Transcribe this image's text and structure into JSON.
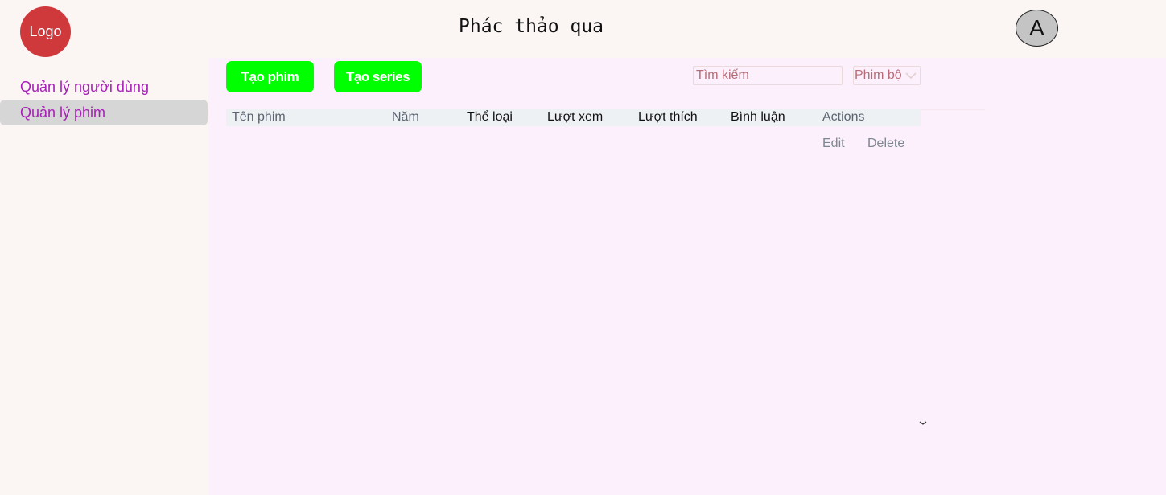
{
  "header": {
    "logo_text": "Logo",
    "title": "Phác thảo qua",
    "avatar_letter": "A"
  },
  "sidebar": {
    "items": [
      {
        "label": "Quản lý người dùng",
        "active": false
      },
      {
        "label": "Quản lý phim",
        "active": true
      }
    ]
  },
  "toolbar": {
    "create_movie_label": "Tạo phim",
    "create_series_label": "Tạo series",
    "button_color": "#00ff00",
    "search_placeholder": "Tìm kiếm",
    "filter_selected": "Phim bộ"
  },
  "table": {
    "columns": [
      "Tên phim",
      "Năm",
      "Thể loại",
      "Lượt xem",
      "Lượt thích",
      "Bình luận",
      "Actions"
    ],
    "row_actions": [
      "Edit",
      "Delete"
    ]
  },
  "colors": {
    "sidebar_text": "#a61fb6",
    "logo_bg": "#d0393c",
    "main_bg": "#fbf0fb"
  },
  "icons": {
    "filter_dropdown": "chevron-down-icon",
    "scroll_indicator": "chevron-down-icon"
  }
}
